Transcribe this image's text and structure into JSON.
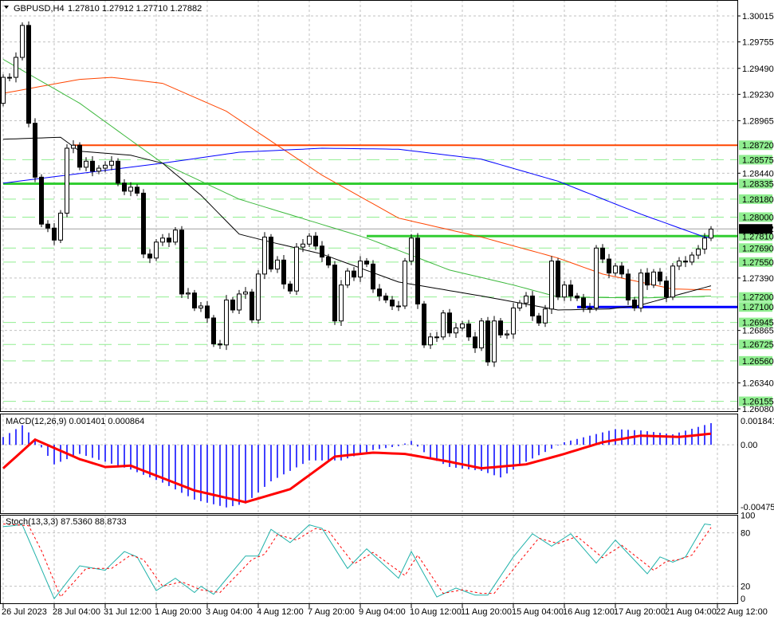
{
  "header": {
    "symbol": "GBPUSD,H4",
    "ohlc": "1.27810 1.27912 1.27710 1.27882"
  },
  "colors": {
    "bull_body": "#ffffff",
    "bear_body": "#000000",
    "level_label_bg": "#90ee90",
    "grid": "#c0c0c0"
  },
  "chart_data": [
    {
      "type": "candlestick",
      "title": "GBPUSD,H4",
      "ylim": [
        1.2608,
        1.30015
      ],
      "first_open": 1.2914,
      "closes": [
        1.294,
        1.294,
        1.296,
        1.2992,
        1.2894,
        1.284,
        1.2793,
        1.2789,
        1.2777,
        1.2804,
        1.2869,
        1.2872,
        1.285,
        1.2856,
        1.2846,
        1.2849,
        1.2852,
        1.2856,
        1.2834,
        1.2826,
        1.283,
        1.2824,
        1.2763,
        1.2759,
        1.2775,
        1.2779,
        1.2775,
        1.2787,
        1.2723,
        1.2724,
        1.2709,
        1.2711,
        1.2699,
        1.2673,
        1.2672,
        1.2717,
        1.2707,
        1.2723,
        1.2725,
        1.2697,
        1.2743,
        1.278,
        1.2748,
        1.2757,
        1.2733,
        1.2726,
        1.277,
        1.2773,
        1.2781,
        1.2771,
        1.276,
        1.2752,
        1.2696,
        1.2732,
        1.2746,
        1.274,
        1.2756,
        1.2753,
        1.2728,
        1.2721,
        1.2717,
        1.2711,
        1.2711,
        1.2756,
        1.2779,
        1.2713,
        1.2672,
        1.268,
        1.268,
        1.2704,
        1.2684,
        1.2689,
        1.2693,
        1.268,
        1.2669,
        1.2696,
        1.2655,
        1.2696,
        1.2682,
        1.2683,
        1.2709,
        1.2714,
        1.2721,
        1.2701,
        1.2694,
        1.2708,
        1.2756,
        1.272,
        1.2732,
        1.2721,
        1.2719,
        1.2709,
        1.2709,
        1.2769,
        1.2758,
        1.2744,
        1.2751,
        1.2743,
        1.2717,
        1.2709,
        1.2744,
        1.2732,
        1.2745,
        1.2736,
        1.272,
        1.2751,
        1.2756,
        1.2755,
        1.2762,
        1.2768,
        1.2779,
        1.2788
      ],
      "current_price": "1.27882",
      "moving_averages": [
        {
          "name": "ma-orange",
          "color": "#ff4500",
          "points": [
            [
              0,
              1.2924
            ],
            [
              12,
              1.2938
            ],
            [
              17,
              1.294
            ],
            [
              25,
              1.2934
            ],
            [
              35,
              1.2906
            ],
            [
              50,
              1.2842
            ],
            [
              62,
              1.2799
            ],
            [
              75,
              1.278
            ],
            [
              87,
              1.2759
            ],
            [
              94,
              1.2743
            ],
            [
              105,
              1.2728
            ],
            [
              112,
              1.2727
            ]
          ]
        },
        {
          "name": "ma-green",
          "color": "#3cb83c",
          "points": [
            [
              0,
              1.2958
            ],
            [
              12,
              1.2914
            ],
            [
              25,
              1.2854
            ],
            [
              37,
              1.2818
            ],
            [
              57,
              1.2779
            ],
            [
              70,
              1.2747
            ],
            [
              80,
              1.2732
            ],
            [
              87,
              1.272
            ],
            [
              100,
              1.2719
            ],
            [
              112,
              1.2721
            ]
          ]
        },
        {
          "name": "ma-blue",
          "color": "#0000ff",
          "points": [
            [
              0,
              1.2834
            ],
            [
              25,
              1.2854
            ],
            [
              37,
              1.2865
            ],
            [
              50,
              1.2869
            ],
            [
              62,
              1.2868
            ],
            [
              75,
              1.2858
            ],
            [
              87,
              1.2836
            ],
            [
              100,
              1.2803
            ],
            [
              110,
              1.278
            ],
            [
              112,
              1.2779
            ]
          ]
        },
        {
          "name": "ma-black",
          "color": "#000000",
          "points": [
            [
              0,
              1.2878
            ],
            [
              9,
              1.288
            ],
            [
              12,
              1.2866
            ],
            [
              20,
              1.2862
            ],
            [
              25,
              1.2854
            ],
            [
              31,
              1.2822
            ],
            [
              37,
              1.2783
            ],
            [
              42,
              1.2775
            ],
            [
              50,
              1.2763
            ],
            [
              62,
              1.2735
            ],
            [
              75,
              1.2721
            ],
            [
              87,
              1.2707
            ],
            [
              95,
              1.2708
            ],
            [
              100,
              1.2712
            ],
            [
              112,
              1.2733
            ]
          ]
        }
      ],
      "levels": [
        {
          "price": 1.2872,
          "label": "1.28720",
          "color": "#ff4500",
          "from": 11,
          "style": "solid"
        },
        {
          "price": 1.28335,
          "label": "1.28335",
          "color": "#32cd32",
          "from": 0,
          "style": "thick"
        },
        {
          "price": 1.2781,
          "label": "1.27810",
          "color": "#32cd32",
          "from": 57,
          "style": "thick"
        },
        {
          "price": 1.271,
          "label": "1.27100",
          "color": "#0000ff",
          "from": 90,
          "style": "thick"
        },
        {
          "price": 1.28575,
          "label": "1.28575",
          "color": "#90ee90",
          "from": 0,
          "style": "dash"
        },
        {
          "price": 1.2818,
          "label": "1.28180",
          "color": "#90ee90",
          "from": 0,
          "style": "dash"
        },
        {
          "price": 1.28,
          "label": "1.28000",
          "color": "#90ee90",
          "from": 0,
          "style": "dash"
        },
        {
          "price": 1.2769,
          "label": "1.27690",
          "color": "#90ee90",
          "from": 0,
          "style": "dash"
        },
        {
          "price": 1.2755,
          "label": "1.27550",
          "color": "#90ee90",
          "from": 0,
          "style": "dash"
        },
        {
          "price": 1.272,
          "label": "1.27200",
          "color": "#90ee90",
          "from": 0,
          "style": "dash"
        },
        {
          "price": 1.26945,
          "label": "1.26945",
          "color": "#90ee90",
          "from": 0,
          "style": "dash"
        },
        {
          "price": 1.26725,
          "label": "1.26725",
          "color": "#90ee90",
          "from": 0,
          "style": "dash"
        },
        {
          "price": 1.2656,
          "label": "1.26560",
          "color": "#90ee90",
          "from": 0,
          "style": "dash"
        },
        {
          "price": 1.26155,
          "label": "1.26155",
          "color": "#90ee90",
          "from": 0,
          "style": "dash"
        }
      ],
      "y_ticks": [
        "1.30015",
        "1.29755",
        "1.29490",
        "1.29230",
        "1.28965",
        "1.28440",
        "1.27390",
        "1.26865",
        "1.26340",
        "1.26080"
      ],
      "x_tick_labels": [
        "26 Jul 2023",
        "28 Jul 04:00",
        "31 Jul 12:00",
        "1 Aug 20:00",
        "3 Aug 04:00",
        "4 Aug 12:00",
        "7 Aug 20:00",
        "9 Aug 04:00",
        "10 Aug 12:00",
        "11 Aug 20:00",
        "15 Aug 04:00",
        "16 Aug 12:00",
        "17 Aug 20:00",
        "21 Aug 04:00",
        "22 Aug 12:00"
      ],
      "x_tick_every": 8,
      "grid": true
    },
    {
      "type": "bar",
      "title": "MACD(12,26,9) 0.001401 0.000864",
      "ylim": [
        -0.004755,
        0.001841
      ],
      "y_ticks": [
        "0.001841",
        "0.00",
        "-0.004755"
      ],
      "histogram_points": [
        [
          0,
          0.0006
        ],
        [
          3,
          0.0015
        ],
        [
          5,
          0.0004
        ],
        [
          6,
          -0.0002
        ],
        [
          8,
          -0.0015
        ],
        [
          12,
          -0.0007
        ],
        [
          20,
          -0.0019
        ],
        [
          25,
          -0.0029
        ],
        [
          30,
          -0.0042
        ],
        [
          35,
          -0.0048
        ],
        [
          38,
          -0.0045
        ],
        [
          42,
          -0.0028
        ],
        [
          48,
          -0.0012
        ],
        [
          53,
          -0.0012
        ],
        [
          58,
          -0.0004
        ],
        [
          62,
          -0.0001
        ],
        [
          64,
          0.0003
        ],
        [
          67,
          -0.001
        ],
        [
          70,
          -0.0017
        ],
        [
          75,
          -0.002
        ],
        [
          78,
          -0.0025
        ],
        [
          82,
          -0.0013
        ],
        [
          86,
          -0.0003
        ],
        [
          88,
          0.0002
        ],
        [
          92,
          0.0007
        ],
        [
          96,
          0.0012
        ],
        [
          100,
          0.0011
        ],
        [
          105,
          0.0008
        ],
        [
          112,
          0.0018
        ]
      ],
      "signal_points": [
        [
          0,
          -0.0018
        ],
        [
          5,
          0.0004
        ],
        [
          12,
          -0.0011
        ],
        [
          16,
          -0.0017
        ],
        [
          20,
          -0.0016
        ],
        [
          30,
          -0.0035
        ],
        [
          38,
          -0.0044
        ],
        [
          45,
          -0.0034
        ],
        [
          52,
          -0.0009
        ],
        [
          58,
          -0.0006
        ],
        [
          63,
          -0.0007
        ],
        [
          70,
          -0.0013
        ],
        [
          75,
          -0.0018
        ],
        [
          82,
          -0.0015
        ],
        [
          88,
          -0.0007
        ],
        [
          94,
          0.0002
        ],
        [
          100,
          0.0007
        ],
        [
          106,
          0.0006
        ],
        [
          112,
          0.0009
        ]
      ]
    },
    {
      "type": "line",
      "title": "Stoch(13,3,3) 87.5360 88.8733",
      "ylim": [
        0,
        100
      ],
      "y_ticks": [
        "100",
        "80",
        "20",
        "0"
      ],
      "series": [
        {
          "name": "%K",
          "color": "#20b2aa",
          "points": [
            [
              0,
              87
            ],
            [
              3,
              89
            ],
            [
              5,
              56
            ],
            [
              8,
              6
            ],
            [
              12,
              43
            ],
            [
              16,
              38
            ],
            [
              19,
              59
            ],
            [
              21,
              53
            ],
            [
              24,
              15
            ],
            [
              27,
              29
            ],
            [
              30,
              13
            ],
            [
              31,
              20
            ],
            [
              33,
              11
            ],
            [
              38,
              54
            ],
            [
              40,
              54
            ],
            [
              42,
              84
            ],
            [
              45,
              69
            ],
            [
              48,
              89
            ],
            [
              50,
              85
            ],
            [
              54,
              40
            ],
            [
              57,
              62
            ],
            [
              62,
              29
            ],
            [
              64,
              59
            ],
            [
              68,
              8
            ],
            [
              71,
              18
            ],
            [
              74,
              10
            ],
            [
              76,
              10
            ],
            [
              80,
              53
            ],
            [
              83,
              79
            ],
            [
              86,
              65
            ],
            [
              89,
              79
            ],
            [
              93,
              46
            ],
            [
              96,
              72
            ],
            [
              101,
              34
            ],
            [
              103,
              53
            ],
            [
              105,
              47
            ],
            [
              107,
              53
            ],
            [
              110,
              90
            ],
            [
              112,
              88
            ]
          ]
        },
        {
          "name": "%D",
          "color": "#ff0000",
          "points": [
            [
              0,
              90
            ],
            [
              4,
              88
            ],
            [
              6,
              60
            ],
            [
              9,
              8
            ],
            [
              13,
              40
            ],
            [
              17,
              40
            ],
            [
              20,
              55
            ],
            [
              22,
              50
            ],
            [
              25,
              20
            ],
            [
              28,
              25
            ],
            [
              31,
              16
            ],
            [
              34,
              13
            ],
            [
              39,
              50
            ],
            [
              41,
              56
            ],
            [
              43,
              78
            ],
            [
              46,
              72
            ],
            [
              49,
              85
            ],
            [
              51,
              82
            ],
            [
              55,
              45
            ],
            [
              58,
              58
            ],
            [
              63,
              32
            ],
            [
              65,
              55
            ],
            [
              69,
              12
            ],
            [
              72,
              16
            ],
            [
              75,
              12
            ],
            [
              77,
              12
            ],
            [
              81,
              48
            ],
            [
              84,
              74
            ],
            [
              87,
              68
            ],
            [
              90,
              76
            ],
            [
              94,
              52
            ],
            [
              97,
              66
            ],
            [
              102,
              38
            ],
            [
              104,
              48
            ],
            [
              106,
              50
            ],
            [
              108,
              55
            ],
            [
              111,
              86
            ],
            [
              112,
              89
            ]
          ]
        }
      ]
    }
  ]
}
